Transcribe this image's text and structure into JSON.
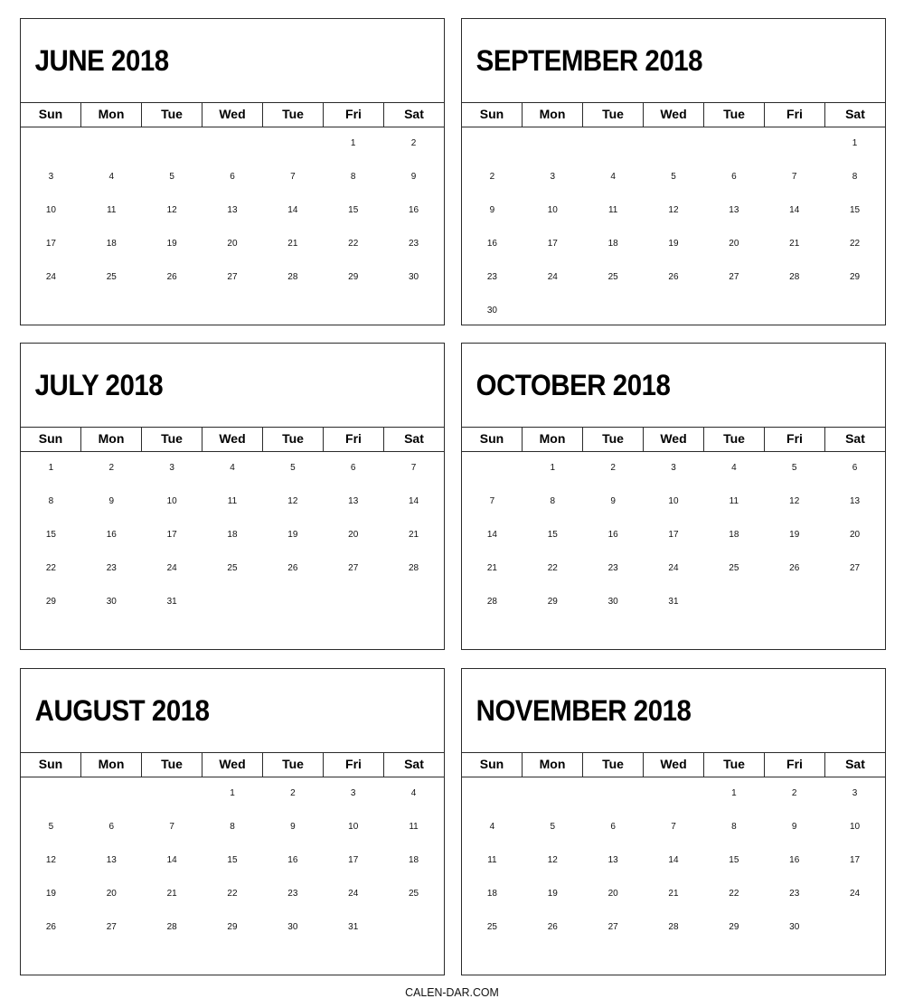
{
  "weekday_headers": [
    "Sun",
    "Mon",
    "Tue",
    "Wed",
    "Tue",
    "Fri",
    "Sat"
  ],
  "months": [
    {
      "title": "JUNE 2018",
      "weeks": [
        [
          "",
          "",
          "",
          "",
          "",
          "1",
          "2"
        ],
        [
          "3",
          "4",
          "5",
          "6",
          "7",
          "8",
          "9"
        ],
        [
          "10",
          "11",
          "12",
          "13",
          "14",
          "15",
          "16"
        ],
        [
          "17",
          "18",
          "19",
          "20",
          "21",
          "22",
          "23"
        ],
        [
          "24",
          "25",
          "26",
          "27",
          "28",
          "29",
          "30"
        ]
      ]
    },
    {
      "title": "SEPTEMBER 2018",
      "weeks": [
        [
          "",
          "",
          "",
          "",
          "",
          "",
          "1"
        ],
        [
          "2",
          "3",
          "4",
          "5",
          "6",
          "7",
          "8"
        ],
        [
          "9",
          "10",
          "11",
          "12",
          "13",
          "14",
          "15"
        ],
        [
          "16",
          "17",
          "18",
          "19",
          "20",
          "21",
          "22"
        ],
        [
          "23",
          "24",
          "25",
          "26",
          "27",
          "28",
          "29"
        ],
        [
          "30",
          "",
          "",
          "",
          "",
          "",
          ""
        ]
      ]
    },
    {
      "title": "JULY 2018",
      "weeks": [
        [
          "1",
          "2",
          "3",
          "4",
          "5",
          "6",
          "7"
        ],
        [
          "8",
          "9",
          "10",
          "11",
          "12",
          "13",
          "14"
        ],
        [
          "15",
          "16",
          "17",
          "18",
          "19",
          "20",
          "21"
        ],
        [
          "22",
          "23",
          "24",
          "25",
          "26",
          "27",
          "28"
        ],
        [
          "29",
          "30",
          "31",
          "",
          "",
          "",
          ""
        ]
      ]
    },
    {
      "title": "OCTOBER 2018",
      "weeks": [
        [
          "",
          "1",
          "2",
          "3",
          "4",
          "5",
          "6"
        ],
        [
          "7",
          "8",
          "9",
          "10",
          "11",
          "12",
          "13"
        ],
        [
          "14",
          "15",
          "16",
          "17",
          "18",
          "19",
          "20"
        ],
        [
          "21",
          "22",
          "23",
          "24",
          "25",
          "26",
          "27"
        ],
        [
          "28",
          "29",
          "30",
          "31",
          "",
          "",
          ""
        ]
      ]
    },
    {
      "title": "AUGUST 2018",
      "weeks": [
        [
          "",
          "",
          "",
          "1",
          "2",
          "3",
          "4"
        ],
        [
          "5",
          "6",
          "7",
          "8",
          "9",
          "10",
          "11"
        ],
        [
          "12",
          "13",
          "14",
          "15",
          "16",
          "17",
          "18"
        ],
        [
          "19",
          "20",
          "21",
          "22",
          "23",
          "24",
          "25"
        ],
        [
          "26",
          "27",
          "28",
          "29",
          "30",
          "31",
          ""
        ]
      ]
    },
    {
      "title": "NOVEMBER 2018",
      "weeks": [
        [
          "",
          "",
          "",
          "",
          "1",
          "2",
          "3"
        ],
        [
          "4",
          "5",
          "6",
          "7",
          "8",
          "9",
          "10"
        ],
        [
          "11",
          "12",
          "13",
          "14",
          "15",
          "16",
          "17"
        ],
        [
          "18",
          "19",
          "20",
          "21",
          "22",
          "23",
          "24"
        ],
        [
          "25",
          "26",
          "27",
          "28",
          "29",
          "30",
          ""
        ]
      ]
    }
  ],
  "footer": {
    "site": "CALEN-DAR.COM"
  }
}
